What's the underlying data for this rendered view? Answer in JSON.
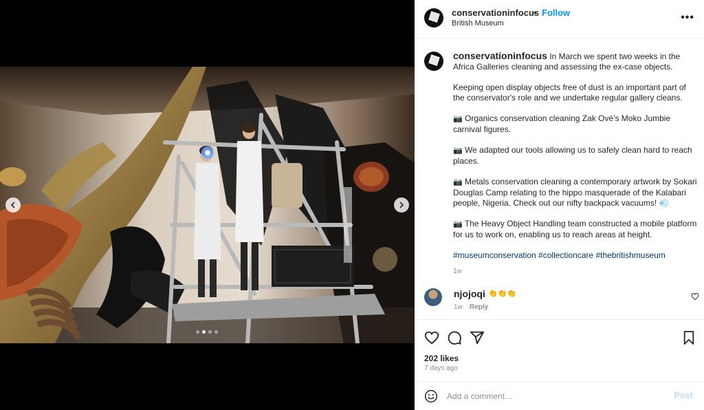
{
  "header": {
    "username": "conservationinfocus",
    "bullet": "•",
    "follow_label": "Follow",
    "location": "British Museum",
    "more_label": "•••"
  },
  "caption": {
    "username": "conservationinfocus",
    "intro": "In March we spent two weeks in the Africa Galleries cleaning and assessing the ex-case objects.",
    "paragraph_2": "Keeping open display objects free of dust is an important part of the conservator's role and we undertake regular gallery cleans.",
    "camera_icon": "📷",
    "item_1": "Organics conservation cleaning Zak Ové's Moko Jumbie carnival figures.",
    "item_2": "We adapted our tools allowing us to safely clean hard to reach places.",
    "item_3": "Metals conservation cleaning a contemporary artwork by Sokari Douglas Camp relating to the hippo masquerade of the Kalabari people, Nigeria. Check out our nifty backpack vacuums! 💨",
    "item_4": "The Heavy Object Handling team constructed a mobile platform for us to work on, enabling us to reach areas at height.",
    "hashtags": "#museumconservation #collectioncare #thebritishmuseum",
    "time": "1w"
  },
  "comment": {
    "username": "njojoqi",
    "text": "👏👏👏",
    "time": "1w",
    "reply_label": "Reply"
  },
  "actions": {
    "likes": "202 likes",
    "posted": "7 days ago"
  },
  "add_comment": {
    "placeholder": "Add a comment…",
    "post_label": "Post"
  },
  "carousel": {
    "slide_count": 4,
    "active_index": 1
  },
  "colors": {
    "follow": "#0095f6",
    "hashtag": "#00376b",
    "post_disabled": "#c0dffd",
    "muted": "#8e8e8e"
  }
}
